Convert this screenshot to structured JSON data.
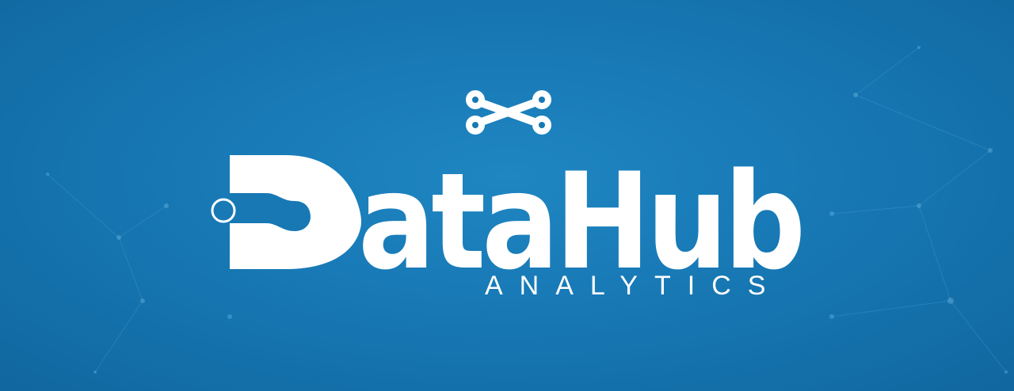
{
  "brand": {
    "name": "DataHub",
    "tagline": "ANALYTICS",
    "logo_icon": "bone-connector-icon"
  },
  "colors": {
    "background": "#1778b4",
    "background_dark": "#11679f",
    "foreground": "#ffffff"
  }
}
